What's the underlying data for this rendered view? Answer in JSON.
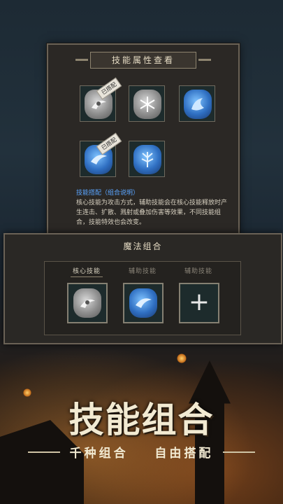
{
  "skill_panel": {
    "title": "技能属性查看",
    "badge_equipped": "已搭配",
    "desc_title": "技能搭配（组合说明）",
    "desc_text": "核心技能为攻击方式，辅助技能会在核心技能释放时产生连击、扩散、溅射或叠加伤害等效果，不同技能组合，技能特效也会改变。",
    "runes": [
      {
        "icon": "swirl-icon",
        "color": "grey",
        "equipped": true
      },
      {
        "icon": "snowflake-icon",
        "color": "grey",
        "equipped": false
      },
      {
        "icon": "flame-icon",
        "color": "blue",
        "equipped": false
      },
      {
        "icon": "wind-icon",
        "color": "blue",
        "equipped": true
      },
      {
        "icon": "tree-icon",
        "color": "blue",
        "equipped": false
      }
    ]
  },
  "combo_panel": {
    "title": "魔法组合",
    "tabs": [
      "核心技能",
      "辅助技能",
      "辅助技能"
    ],
    "slots": [
      {
        "icon": "swirl-icon",
        "color": "grey"
      },
      {
        "icon": "wind-icon",
        "color": "blue"
      },
      {
        "icon": "plus-icon",
        "color": "empty"
      }
    ]
  },
  "banner": {
    "title": "技能组合",
    "slogan_left": "千种组合",
    "slogan_right": "自由搭配"
  },
  "colors": {
    "accent_blue": "#5aa5ff",
    "panel_border": "#6a6256",
    "text_light": "#e6dcc4"
  }
}
